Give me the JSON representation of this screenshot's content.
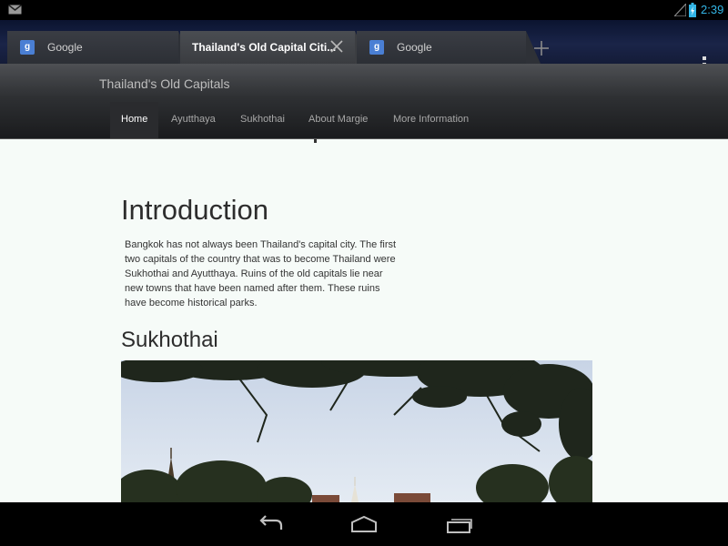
{
  "status_bar": {
    "notification_icon": "gmail-icon",
    "signal_icon": "signal-icon",
    "battery_icon": "battery-charging-icon",
    "time": "2:39",
    "time_color": "#33b5e5"
  },
  "browser": {
    "tabs": [
      {
        "label": "Google",
        "favicon": "g",
        "active": false
      },
      {
        "label": "Thailand's Old Capital Citi...",
        "active": true
      },
      {
        "label": "Google",
        "favicon": "g",
        "active": false
      }
    ],
    "close_tab_icon": "close-icon",
    "new_tab_icon": "plus-icon",
    "menu_icon": "overflow-menu-icon"
  },
  "site": {
    "title": "Thailand's Old Capitals",
    "nav": [
      "Home",
      "Ayutthaya",
      "Sukhothai",
      "About Margie",
      "More Information"
    ],
    "active_nav": "Home"
  },
  "content": {
    "intro_heading": "Introduction",
    "intro_body": "Bangkok has not always been Thailand's capital city. The first two capitals of the country that was to become Thailand were Sukhothai and Ayutthaya. Ruins of the old capitals lie near new towns that have been named after them. These ruins have become historical parks.",
    "sukhothai_heading": "Sukhothai"
  },
  "system_nav": {
    "back_icon": "back-icon",
    "home_icon": "home-icon",
    "recents_icon": "recent-apps-icon"
  },
  "colors": {
    "accent": "#33b5e5",
    "content_background": "#f6fbf8",
    "header_background": "#2e3033"
  }
}
